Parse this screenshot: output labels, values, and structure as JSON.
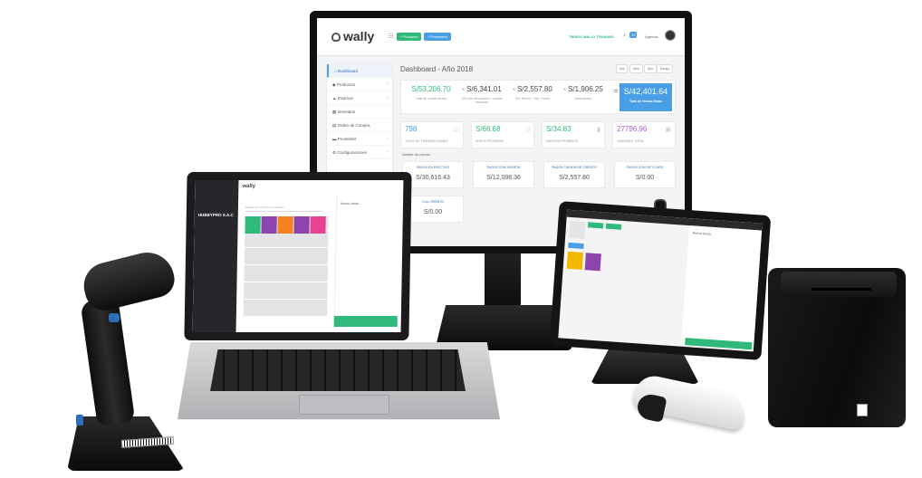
{
  "monitor": {
    "logo": "wally",
    "top_buttons": {
      "productos": "+ Producto",
      "proveedor": "+ Proveedor"
    },
    "tienda": "TIENDA WALLY TRAINING",
    "notif_count": "10",
    "user": "Agencia",
    "sidebar": [
      {
        "label": "Dashboard",
        "icon": "home-icon"
      },
      {
        "label": "Productos",
        "icon": "tag-icon"
      },
      {
        "label": "Insumos",
        "icon": "boxes-icon"
      },
      {
        "label": "Inventario",
        "icon": "table-icon"
      },
      {
        "label": "Orden de Compra",
        "icon": "document-icon"
      },
      {
        "label": "Proveedor",
        "icon": "truck-icon"
      },
      {
        "label": "Configuraciones",
        "icon": "gear-icon"
      }
    ],
    "dashboard_title": "Dashboard - Año 2018",
    "period_buttons": [
      "Día",
      "Mes",
      "Año",
      "Rango"
    ],
    "summary": [
      {
        "value": "S/53,206.70",
        "label": "Total de ventas brutas"
      },
      {
        "value": "- S/6,341.01",
        "label": "IGV con devolución + ventas anuladas"
      },
      {
        "value": "- S/2,557.80",
        "label": "IGV Dinero + Ser. Fondo"
      },
      {
        "value": "- S/1,906.25",
        "label": "Descuentos"
      }
    ],
    "summary_eq": "=",
    "total": {
      "value": "S/42,401.64",
      "label": "Total de Ventas Netas"
    },
    "stats": [
      {
        "value": "798",
        "label": "TOTAL DE TRANSACCIONES",
        "color": "#4a9ee6",
        "icon": "cart-icon"
      },
      {
        "value": "S/66.68",
        "label": "VENTA PROMEDIO",
        "color": "#2fb97a",
        "icon": "clipboard-icon"
      },
      {
        "value": "S/34.83",
        "label": "MARGEN PROMEDIO",
        "color": "#2fb97a",
        "icon": "bar-chart-icon"
      },
      {
        "value": "27796.96",
        "label": "UNIDADES TOTAL",
        "color": "#b05fd4",
        "icon": "cube-icon"
      }
    ],
    "detalle": "Detalle de cobros",
    "pagos": [
      {
        "label": "PAGOS EN EFECTIVO",
        "value": "S/30,616.43"
      },
      {
        "label": "PAGOS CON TARJETA",
        "value": "S/12,098.36"
      },
      {
        "label": "PAGOS CUENTA DE CRÉDITO",
        "value": "S/2,557.80"
      },
      {
        "label": "PAGOS CON GIFT CARD",
        "value": "S/0.00"
      }
    ],
    "credito": {
      "label": "O AL CRÉDITO",
      "value": "S/0.00"
    }
  },
  "laptop": {
    "company": "HUBBYPRO S.A.C",
    "logo": "wally",
    "search_placeholder": "Buscar por nombre de producto",
    "order_title": "Nueva Venta",
    "pay_label": "Cobrar"
  },
  "tablet": {
    "order_title": "Nueva Venta",
    "pay_label": "Cobrar"
  },
  "colors": {
    "green": "#2fb97a",
    "blue": "#4a9ee6",
    "orange": "#f58220",
    "purple": "#8e44ad",
    "pink": "#e84393"
  }
}
